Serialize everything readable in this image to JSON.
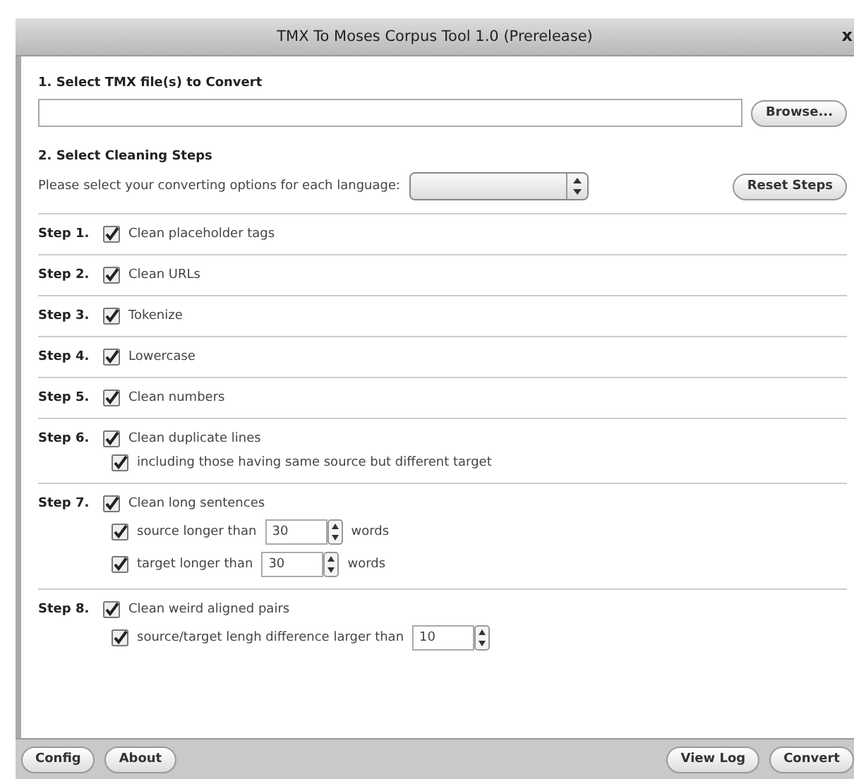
{
  "window": {
    "title": "TMX To Moses Corpus Tool 1.0 (Prerelease)",
    "close": "x"
  },
  "section1": {
    "heading": "1. Select TMX file(s) to Convert",
    "browse": "Browse..."
  },
  "section2": {
    "heading": "2. Select Cleaning Steps",
    "prompt": "Please select your converting options for each language:",
    "reset": "Reset Steps"
  },
  "steps": [
    {
      "label": "Step 1.",
      "checked": true,
      "text": "Clean placeholder tags"
    },
    {
      "label": "Step 2.",
      "checked": true,
      "text": "Clean URLs"
    },
    {
      "label": "Step 3.",
      "checked": true,
      "text": "Tokenize"
    },
    {
      "label": "Step 4.",
      "checked": true,
      "text": "Lowercase"
    },
    {
      "label": "Step 5.",
      "checked": true,
      "text": "Clean numbers"
    },
    {
      "label": "Step 6.",
      "checked": true,
      "text": "Clean duplicate lines",
      "options": [
        {
          "kind": "check",
          "checked": true,
          "text": "including those having same source but different target"
        }
      ]
    },
    {
      "label": "Step 7.",
      "checked": true,
      "text": "Clean long sentences",
      "options": [
        {
          "kind": "number",
          "checked": true,
          "text": "source longer than",
          "value": "30",
          "unit": "words"
        },
        {
          "kind": "number",
          "checked": true,
          "text": "target longer than",
          "value": "30",
          "unit": "words"
        }
      ]
    },
    {
      "label": "Step 8.",
      "checked": true,
      "text": "Clean weird aligned pairs",
      "options": [
        {
          "kind": "number",
          "checked": true,
          "text": "source/target lengh difference larger than",
          "value": "10"
        }
      ]
    }
  ],
  "footer": {
    "left": [
      "Config",
      "About"
    ],
    "right": [
      "View Log",
      "Convert"
    ]
  }
}
